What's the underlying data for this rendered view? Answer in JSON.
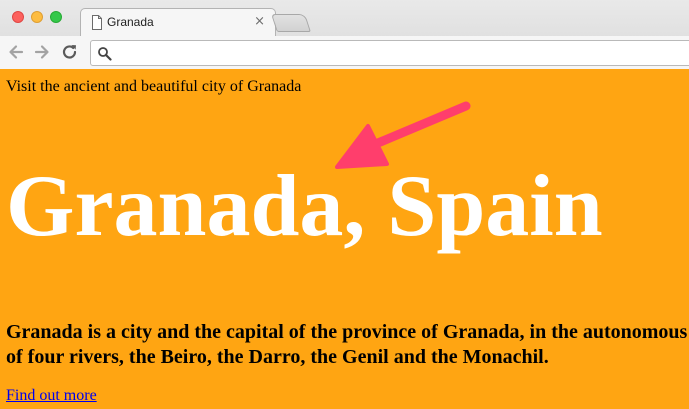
{
  "browser": {
    "tab": {
      "title": "Granada",
      "close_glyph": "×",
      "icon": "document-icon"
    },
    "toolbar": {
      "back_icon": "arrow-left-icon",
      "forward_icon": "arrow-right-icon",
      "reload_icon": "reload-icon",
      "search_icon": "magnifier-icon",
      "address_value": ""
    },
    "window_controls": {
      "close_color": "#fc615d",
      "minimize_color": "#fdbc40",
      "zoom_color": "#34c84a"
    }
  },
  "page": {
    "background_color": "#ffa512",
    "tagline": "Visit the ancient and beautiful city of Granada",
    "heading": "Granada, Spain",
    "description_line1": "Granada is a city and the capital of the province of Granada, in the autonomous",
    "description_line2": "of four rivers, the Beiro, the Darro, the Genil and the Monachil.",
    "link_text": "Find out more",
    "annotation_color": "#ff3e6c"
  }
}
